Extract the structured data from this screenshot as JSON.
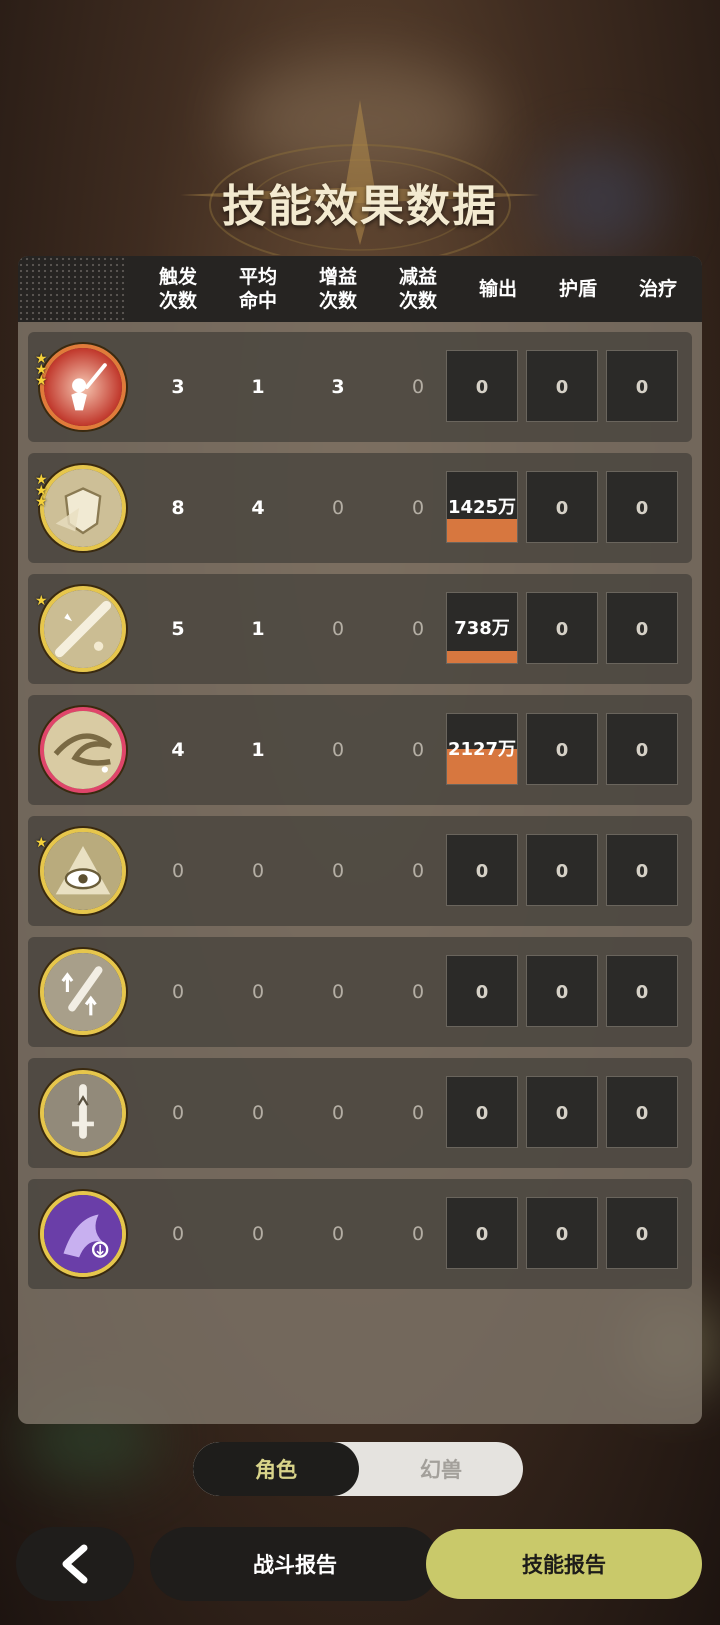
{
  "title": "技能效果数据",
  "columns": [
    "触发\n次数",
    "平均\n命中",
    "增益\n次数",
    "减益\n次数",
    "输出",
    "护盾",
    "治疗"
  ],
  "rows": [
    {
      "icon": "raised-sword-icon",
      "ring": "#e07b3a",
      "stars": 3,
      "trigger": "3",
      "avg_hit": "1",
      "buff": "3",
      "debuff": "0",
      "output": "0",
      "output_fill": 0,
      "shield": "0",
      "heal": "0"
    },
    {
      "icon": "shield-horn-icon",
      "ring": "#e6c64c",
      "stars": 3,
      "trigger": "8",
      "avg_hit": "4",
      "buff": "0",
      "debuff": "0",
      "output": "1425万",
      "output_fill": 0.33,
      "shield": "0",
      "heal": "0"
    },
    {
      "icon": "sword-slash-icon",
      "ring": "#e6c64c",
      "stars": 1,
      "trigger": "5",
      "avg_hit": "1",
      "buff": "0",
      "debuff": "0",
      "output": "738万",
      "output_fill": 0.17,
      "shield": "0",
      "heal": "0"
    },
    {
      "icon": "whirlwind-icon",
      "ring": "#e0456a",
      "stars": 0,
      "trigger": "4",
      "avg_hit": "1",
      "buff": "0",
      "debuff": "0",
      "output": "2127万",
      "output_fill": 0.5,
      "shield": "0",
      "heal": "0"
    },
    {
      "icon": "eye-icon",
      "ring": "#e6c64c",
      "stars": 1,
      "trigger": "0",
      "avg_hit": "0",
      "buff": "0",
      "debuff": "0",
      "output": "0",
      "output_fill": 0,
      "shield": "0",
      "heal": "0"
    },
    {
      "icon": "sword-up-icon",
      "ring": "#e6c64c",
      "stars": 0,
      "trigger": "0",
      "avg_hit": "0",
      "buff": "0",
      "debuff": "0",
      "output": "0",
      "output_fill": 0,
      "shield": "0",
      "heal": "0"
    },
    {
      "icon": "dagger-up-icon",
      "ring": "#e6c64c",
      "stars": 0,
      "trigger": "0",
      "avg_hit": "0",
      "buff": "0",
      "debuff": "0",
      "output": "0",
      "output_fill": 0,
      "shield": "0",
      "heal": "0"
    },
    {
      "icon": "purple-dragon-icon",
      "ring": "#e6c64c",
      "stars": 0,
      "trigger": "0",
      "avg_hit": "0",
      "buff": "0",
      "debuff": "0",
      "output": "0",
      "output_fill": 0,
      "shield": "0",
      "heal": "0"
    }
  ],
  "toggle": {
    "active": "角色",
    "inactive": "幻兽"
  },
  "buttons": {
    "back": "back-arrow-icon",
    "battle_report": "战斗报告",
    "skill_report": "技能报告"
  }
}
